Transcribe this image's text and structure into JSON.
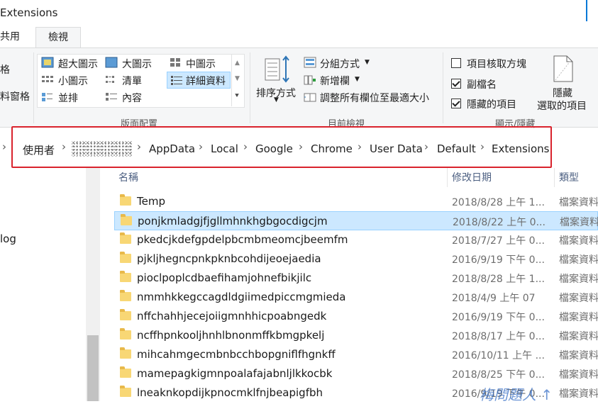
{
  "window": {
    "title": "Extensions"
  },
  "tabs": {
    "share": "共用",
    "view": "檢視"
  },
  "ribbon": {
    "left_cut": {
      "top": "格",
      "bottom": "料窗格"
    },
    "layout": {
      "extra_large": "超大圖示",
      "large": "大圖示",
      "medium": "中圖示",
      "small": "小圖示",
      "list": "清單",
      "details": "詳細資料",
      "tiles": "並排",
      "content": "內容",
      "group_title": "版面配置"
    },
    "current_view": {
      "sort_by": "排序方式",
      "group_by": "分組方式",
      "add_columns": "新增欄",
      "size_columns": "調整所有欄位至最適大小",
      "group_title": "目前檢視"
    },
    "show_hide": {
      "item_checkboxes": "項目核取方塊",
      "item_checkboxes_checked": false,
      "extensions": "副檔名",
      "extensions_checked": true,
      "hidden_items": "隱藏的項目",
      "hidden_items_checked": true,
      "hide_selected_1": "隱藏",
      "hide_selected_2": "選取的項目",
      "group_title": "顯示/隱藏"
    }
  },
  "address": {
    "path": [
      "使用者",
      "AppData",
      "Local",
      "Google",
      "Chrome",
      "User Data",
      "Default",
      "Extensions"
    ],
    "separator": "›"
  },
  "nav": {
    "partial_item": "log"
  },
  "columns": {
    "name": "名稱",
    "date": "修改日期",
    "type": "類型"
  },
  "files": [
    {
      "name": "Temp",
      "date": "2018/8/28 上午 1...",
      "type": "檔案資料",
      "selected": false
    },
    {
      "name": "ponjkmladgjfjgllmhnkhgbgocdigcjm",
      "date": "2018/8/22 上午 0...",
      "type": "檔案資料",
      "selected": true
    },
    {
      "name": "pkedcjkdefgpdelpbcmbmeomcjbeemfm",
      "date": "2018/7/27 上午 0...",
      "type": "檔案資料",
      "selected": false
    },
    {
      "name": "pjkljhegncpnkpknbcohdijeoejaedia",
      "date": "2016/9/19 下午 0...",
      "type": "檔案資料",
      "selected": false
    },
    {
      "name": "pioclpoplcdbaefihamjohnefbikjilc",
      "date": "2018/8/28 上午 1...",
      "type": "檔案資料",
      "selected": false
    },
    {
      "name": "nmmhkkegccagdldgiimedpiccmgmieda",
      "date": "2018/4/9 上午 07",
      "type": "檔案資料",
      "selected": false
    },
    {
      "name": "nffchahhjecejoiigmnhhicpoabngedk",
      "date": "2016/9/19 下午 0...",
      "type": "檔案資料",
      "selected": false
    },
    {
      "name": "ncffhpnkooljhnhlbnonmffkbmgpkelj",
      "date": "2018/8/17 上午 0...",
      "type": "檔案資料",
      "selected": false
    },
    {
      "name": "mihcahmgecmbnbcchbopgniflfhgnkff",
      "date": "2016/10/11 上午 ...",
      "type": "檔案資料",
      "selected": false
    },
    {
      "name": "mamepagkigmnpoalafajabnljlkkocbk",
      "date": "2018/8/25 下午 0...",
      "type": "檔案資料",
      "selected": false
    },
    {
      "name": "lneaknkopdijkpnocmklfnjbeapigfbh",
      "date": "2016/9/19 下午 0...",
      "type": "檔案資料",
      "selected": false
    }
  ],
  "watermark": "梅問題人 ↑"
}
